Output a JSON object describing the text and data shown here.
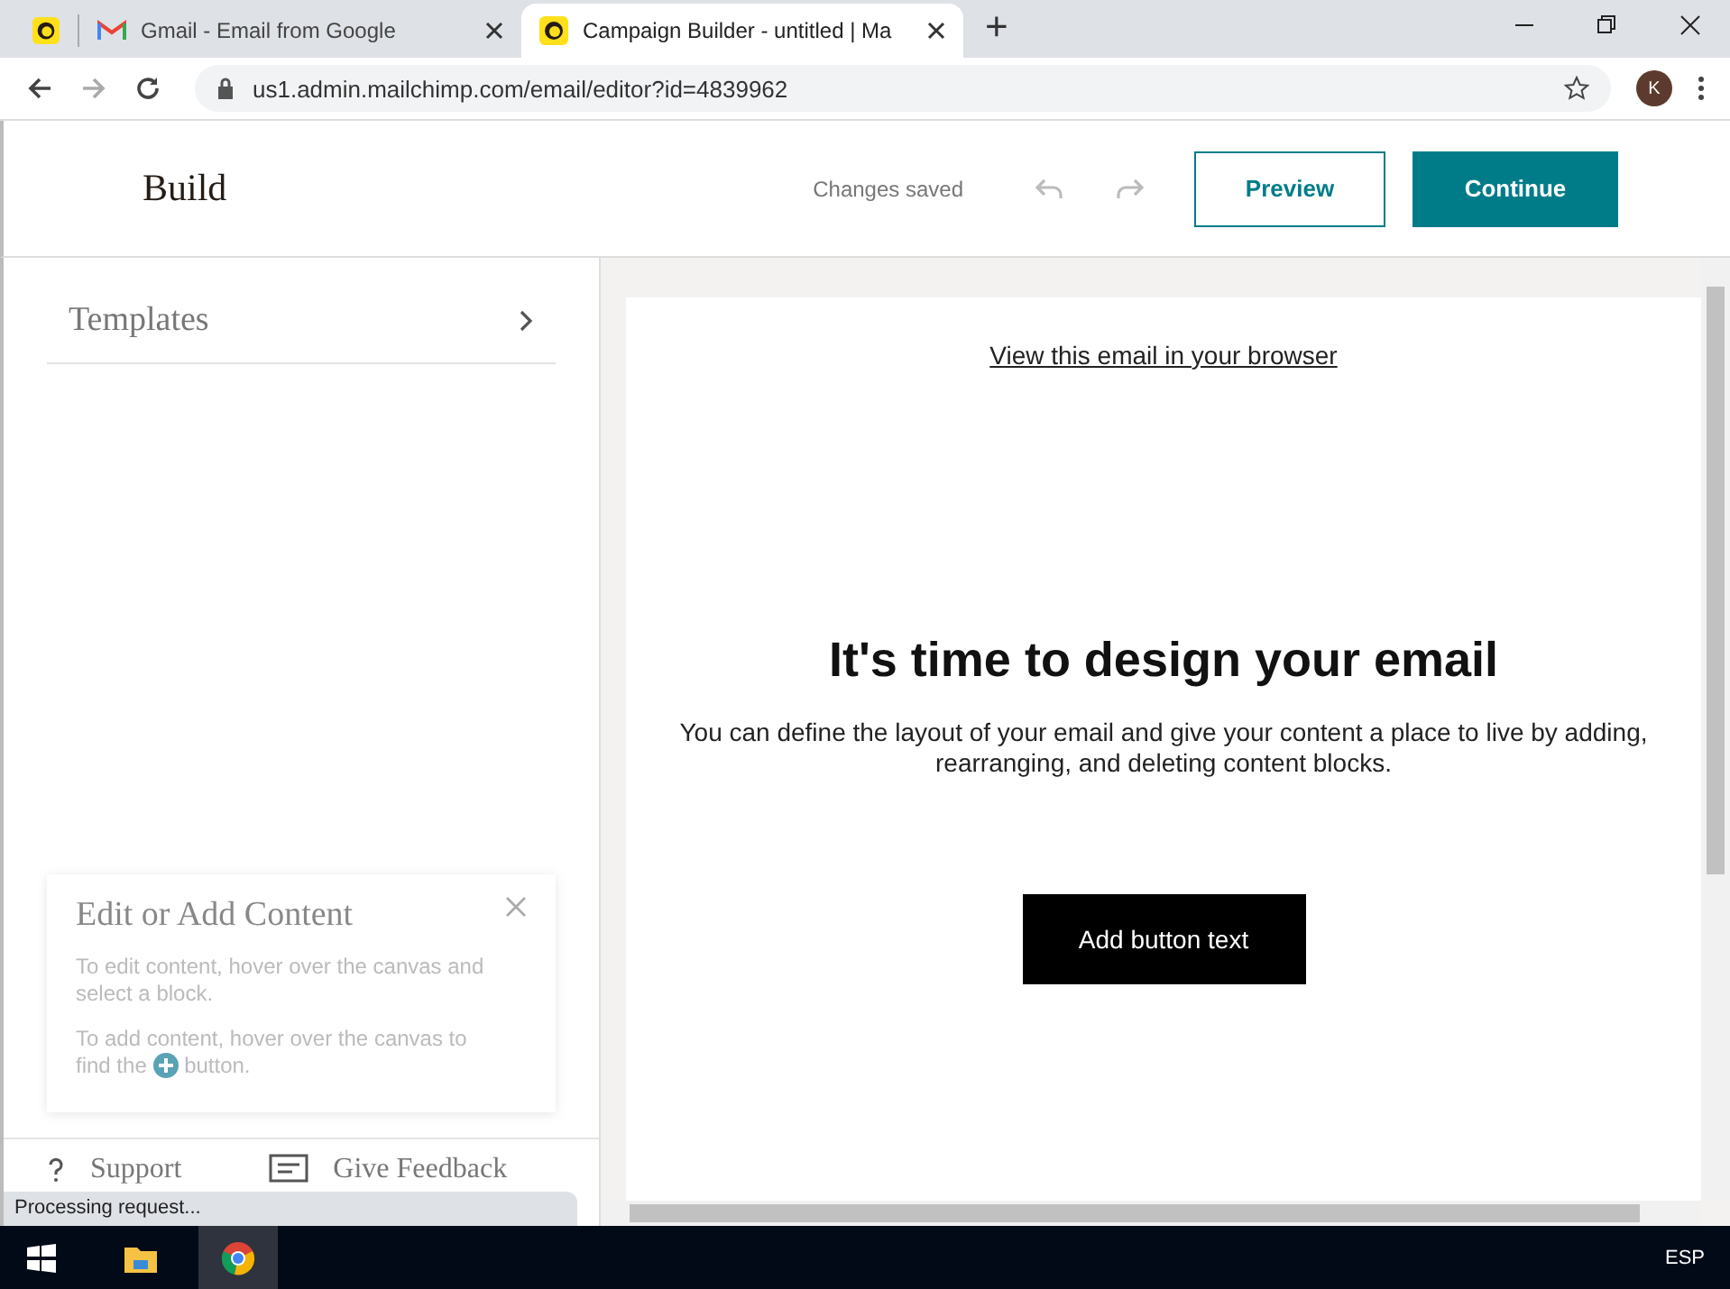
{
  "browser": {
    "tabs": [
      {
        "kind": "pinned",
        "selected": false
      },
      {
        "kind": "gmail",
        "title": "Gmail - Email from Google",
        "selected": false
      },
      {
        "kind": "chimp",
        "title": "Campaign Builder - untitled | Ma",
        "selected": true
      }
    ],
    "new_tab": "+",
    "url": "us1.admin.mailchimp.com/email/editor?id=4839962",
    "avatar": "K"
  },
  "header": {
    "title": "Build",
    "status": "Changes saved",
    "preview": "Preview",
    "continue": "Continue"
  },
  "sidebar": {
    "templates": "Templates",
    "tip": {
      "title": "Edit or Add Content",
      "line1": "To edit content, hover over the canvas and select a block.",
      "line2_a": "To add content, hover over the canvas to",
      "line2_before": "find the",
      "line2_after": "button."
    },
    "footer": [
      {
        "label": "Support",
        "kind": "support"
      },
      {
        "label": "Give Feedback",
        "kind": "feedback"
      }
    ]
  },
  "email": {
    "view_link": "View this email in your browser",
    "heading": "It's time to design your email",
    "body": "You can define the layout of your email and give your content a place to live by adding, rearranging, and deleting content blocks.",
    "button": "Add button text"
  },
  "status_bubble": "Processing request...",
  "taskbar": {
    "language": "ESP"
  }
}
